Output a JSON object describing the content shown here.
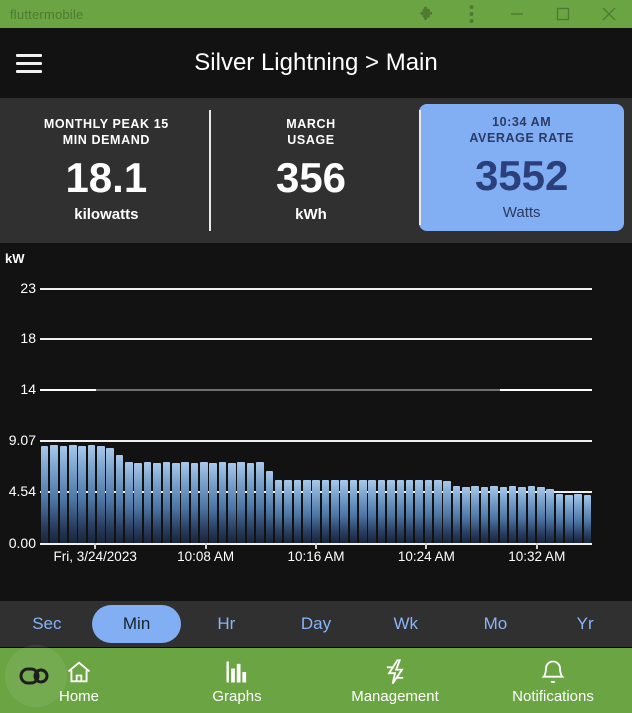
{
  "window": {
    "title": "fluttermobile",
    "controls": [
      {
        "name": "extension-icon",
        "label": "extensions"
      },
      {
        "name": "more-vert-icon",
        "label": "more"
      },
      {
        "name": "minimize-button",
        "label": "minimize"
      },
      {
        "name": "maximize-button",
        "label": "maximize"
      },
      {
        "name": "close-button",
        "label": "close"
      }
    ]
  },
  "appbar": {
    "menu_label": "menu",
    "title": "Silver Lightning > Main"
  },
  "stats": [
    {
      "label_line1": "MONTHLY PEAK 15",
      "label_line2": "MIN DEMAND",
      "value": "18.1",
      "unit": "kilowatts",
      "highlight": false
    },
    {
      "label_line1": "MARCH",
      "label_line2": "USAGE",
      "value": "356",
      "unit": "kWh",
      "highlight": false
    },
    {
      "label_line1": "10:34 AM",
      "label_line2": "AVERAGE RATE",
      "value": "3552",
      "unit": "Watts",
      "highlight": true
    }
  ],
  "colors": {
    "window_chrome": "#6ba543",
    "app_background": "#121212",
    "card_background": "#303030",
    "accent_blue": "#82aef4",
    "accent_text": "#8ab4f8",
    "bar_top": "#a9c8ea",
    "bar_bottom": "#18243a"
  },
  "chart_data": {
    "type": "bar",
    "title": "",
    "xlabel": "",
    "ylabel": "kW",
    "ytick_labels": [
      "23",
      "18",
      "14",
      "9.07",
      "4.54",
      "0.00"
    ],
    "ytick_values": [
      23,
      18,
      14,
      9.07,
      4.54,
      0.0
    ],
    "ylim": [
      0,
      23
    ],
    "grid": true,
    "legend": "none",
    "xtick_labels": [
      "Fri, 3/24/2023",
      "10:08 AM",
      "10:16 AM",
      "10:24 AM",
      "10:32 AM"
    ],
    "x": [
      "10:00 AM",
      "10:01 AM",
      "10:02 AM",
      "10:03 AM",
      "10:04 AM",
      "10:05 AM",
      "10:06 AM",
      "10:07 AM",
      "10:08 AM",
      "10:09 AM",
      "10:10 AM",
      "10:11 AM",
      "10:12 AM",
      "10:13 AM",
      "10:14 AM",
      "10:15 AM",
      "10:16 AM",
      "10:17 AM",
      "10:18 AM",
      "10:19 AM",
      "10:20 AM",
      "10:21 AM",
      "10:22 AM",
      "10:23 AM",
      "10:24 AM",
      "10:25 AM",
      "10:26 AM",
      "10:27 AM",
      "10:28 AM",
      "10:29 AM",
      "10:30 AM",
      "10:31 AM",
      "10:32 AM",
      "10:33 AM",
      "10:34 AM",
      "10:35 AM",
      "10:36 AM",
      "10:37 AM",
      "10:38 AM",
      "10:39 AM",
      "10:40 AM",
      "10:41 AM",
      "10:42 AM",
      "10:43 AM",
      "10:44 AM",
      "10:45 AM",
      "10:46 AM",
      "10:47 AM",
      "10:48 AM",
      "10:49 AM",
      "10:50 AM",
      "10:51 AM",
      "10:52 AM",
      "10:53 AM",
      "10:54 AM",
      "10:55 AM",
      "10:56 AM",
      "10:57 AM",
      "10:58 AM"
    ],
    "values": [
      8.55,
      8.6,
      8.55,
      8.6,
      8.55,
      8.6,
      8.55,
      8.35,
      7.75,
      7.1,
      7.05,
      7.1,
      7.05,
      7.1,
      7.05,
      7.1,
      7.05,
      7.1,
      7.05,
      7.1,
      7.05,
      7.1,
      7.05,
      7.1,
      6.35,
      5.55,
      5.5,
      5.55,
      5.5,
      5.55,
      5.5,
      5.55,
      5.5,
      5.55,
      5.5,
      5.55,
      5.5,
      5.55,
      5.5,
      5.55,
      5.5,
      5.55,
      5.5,
      5.45,
      5.0,
      4.9,
      4.95,
      4.9,
      4.95,
      4.9,
      4.95,
      4.9,
      4.95,
      4.9,
      4.7,
      4.25,
      4.2,
      4.25,
      4.2
    ],
    "unit": "kW"
  },
  "periods": [
    {
      "label": "Sec",
      "active": false
    },
    {
      "label": "Min",
      "active": true
    },
    {
      "label": "Hr",
      "active": false
    },
    {
      "label": "Day",
      "active": false
    },
    {
      "label": "Wk",
      "active": false
    },
    {
      "label": "Mo",
      "active": false
    },
    {
      "label": "Yr",
      "active": false
    }
  ],
  "bottom_nav": [
    {
      "label": "Home",
      "icon": "home-icon",
      "active": false
    },
    {
      "label": "Graphs",
      "icon": "bar-chart-icon",
      "active": true
    },
    {
      "label": "Management",
      "icon": "lightning-bolt-icon",
      "active": false
    },
    {
      "label": "Notifications",
      "icon": "bell-icon",
      "active": false
    }
  ],
  "overlay_button": {
    "icon": "link-chain-icon",
    "label": "accessibility overlay"
  }
}
